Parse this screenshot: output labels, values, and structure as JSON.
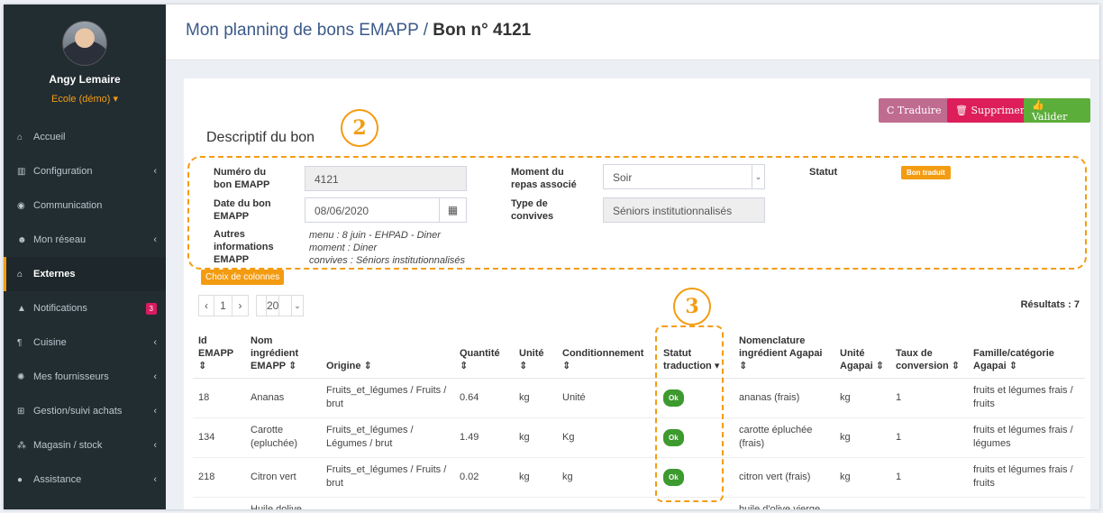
{
  "sidebar": {
    "user_name": "Angy Lemaire",
    "org": "Ecole (démo) ▾",
    "items": [
      {
        "icon": "home-icon",
        "glyph": "⌂",
        "label": "Accueil",
        "chev": ""
      },
      {
        "icon": "bank-icon",
        "glyph": "▥",
        "label": "Configuration",
        "chev": "‹"
      },
      {
        "icon": "comments-icon",
        "glyph": "◉",
        "label": "Communication",
        "chev": ""
      },
      {
        "icon": "users-icon",
        "glyph": "☻",
        "label": "Mon réseau",
        "chev": "‹"
      },
      {
        "icon": "home-icon",
        "glyph": "⌂",
        "label": "Externes",
        "chev": ""
      },
      {
        "icon": "bell-icon",
        "glyph": "▲",
        "label": "Notifications",
        "badge": "3"
      },
      {
        "icon": "cutlery-icon",
        "glyph": "¶",
        "label": "Cuisine",
        "chev": "‹"
      },
      {
        "icon": "handshake-icon",
        "glyph": "✺",
        "label": "Mes fournisseurs",
        "chev": "‹"
      },
      {
        "icon": "cart-icon",
        "glyph": "⊞",
        "label": "Gestion/suivi achats",
        "chev": "‹"
      },
      {
        "icon": "cubes-icon",
        "glyph": "⁂",
        "label": "Magasin / stock",
        "chev": "‹"
      },
      {
        "icon": "info-icon",
        "glyph": "●",
        "label": "Assistance",
        "chev": "‹"
      }
    ]
  },
  "header": {
    "title": "Mon planning de bons EMAPP / ",
    "title_bold": "Bon n° 4121"
  },
  "actions": {
    "traduire": "C Traduire",
    "supprimer": "🗑 Supprimer",
    "valider": "👍 Valider"
  },
  "section_title": "Descriptif du bon",
  "callouts": {
    "two": "2",
    "three": "3"
  },
  "form": {
    "numero_label": "Numéro du bon EMAPP",
    "numero_value": "4121",
    "date_label": "Date du bon EMAPP",
    "date_value": "08/06/2020",
    "autres_label": "Autres informations EMAPP",
    "autres_lines": [
      "menu : 8 juin - EHPAD - Diner",
      "moment : Diner",
      "convives : Séniors institutionnalisés"
    ],
    "moment_label": "Moment du repas associé",
    "moment_value": "Soir",
    "type_label": "Type de convives",
    "type_value": "Séniors institutionnalisés",
    "statut_label": "Statut",
    "statut_value": "Bon traduit"
  },
  "table_controls": {
    "choix_colonnes": "Choix de colonnes",
    "prev": "‹",
    "page": "1",
    "next": "›",
    "page_size": "20",
    "results": "Résultats : 7"
  },
  "table": {
    "headers": [
      "Id EMAPP ⇕",
      "Nom ingrédient EMAPP ⇕",
      "Origine ⇕",
      "Quantité ⇕",
      "Unité ⇕",
      "Conditionnement ⇕",
      "Statut traduction ▾",
      "Nomenclature ingrédient Agapai ⇕",
      "Unité Agapai ⇕",
      "Taux de conversion ⇕",
      "Famille/catégorie Agapai ⇕"
    ],
    "rows": [
      [
        "18",
        "Ananas",
        "Fruits_et_légumes / Fruits / brut",
        "0.64",
        "kg",
        "Unité",
        "Ok",
        "ananas (frais)",
        "kg",
        "1",
        "fruits et légumes frais / fruits"
      ],
      [
        "134",
        "Carotte (epluchée)",
        "Fruits_et_légumes / Légumes / brut",
        "1.49",
        "kg",
        "Kg",
        "Ok",
        "carotte épluchée (frais)",
        "kg",
        "1",
        "fruits et légumes frais / légumes"
      ],
      [
        "218",
        "Citron vert",
        "Fruits_et_légumes / Fruits / brut",
        "0.02",
        "kg",
        "kg",
        "Ok",
        "citron vert (frais)",
        "kg",
        "1",
        "fruits et légumes frais / fruits"
      ],
      [
        "",
        "Huile dolive",
        "",
        "",
        "",
        "",
        "",
        "huile d'olive vierge",
        "",
        "",
        ""
      ]
    ]
  },
  "colors": {
    "accent": "#f39c12",
    "sidebar": "#222d32",
    "ok": "#3c9a2e"
  }
}
